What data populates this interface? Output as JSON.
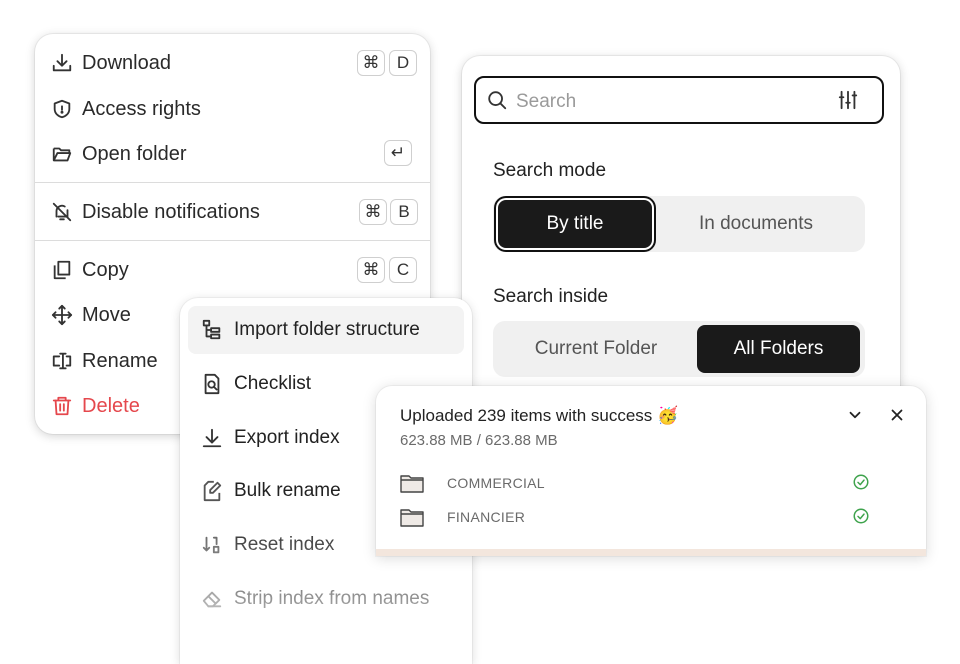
{
  "context_menu": {
    "download": {
      "label": "Download",
      "keys": [
        "⌘",
        "D"
      ]
    },
    "access_rights": {
      "label": "Access rights"
    },
    "open_folder": {
      "label": "Open folder",
      "key": "↵"
    },
    "disable_notifications": {
      "label": "Disable notifications",
      "keys": [
        "⌘",
        "B"
      ]
    },
    "copy": {
      "label": "Copy",
      "keys": [
        "⌘",
        "C"
      ]
    },
    "move": {
      "label": "Move"
    },
    "rename": {
      "label": "Rename"
    },
    "delete": {
      "label": "Delete"
    }
  },
  "search": {
    "placeholder": "Search",
    "mode_title": "Search mode",
    "mode_options": [
      "By title",
      "In documents"
    ],
    "mode_selected": "By title",
    "inside_title": "Search inside",
    "inside_options": [
      "Current Folder",
      "All Folders"
    ],
    "inside_selected": "All Folders"
  },
  "secondary_menu": {
    "items": [
      {
        "label": "Import folder structure"
      },
      {
        "label": "Checklist"
      },
      {
        "label": "Export index"
      },
      {
        "label": "Bulk rename"
      },
      {
        "label": "Reset index"
      },
      {
        "label": "Strip index from names"
      }
    ]
  },
  "upload": {
    "title": "Uploaded 239 items with success",
    "emoji": "🥳",
    "size": "623.88 MB / 623.88 MB",
    "progress": 1.0,
    "files": [
      {
        "name": "COMMERCIAL",
        "status": "done"
      },
      {
        "name": "FINANCIER",
        "status": "done"
      }
    ]
  },
  "colors": {
    "danger": "#e5484d",
    "success": "#3fa34d",
    "active_bg": "#1a1a1a"
  }
}
